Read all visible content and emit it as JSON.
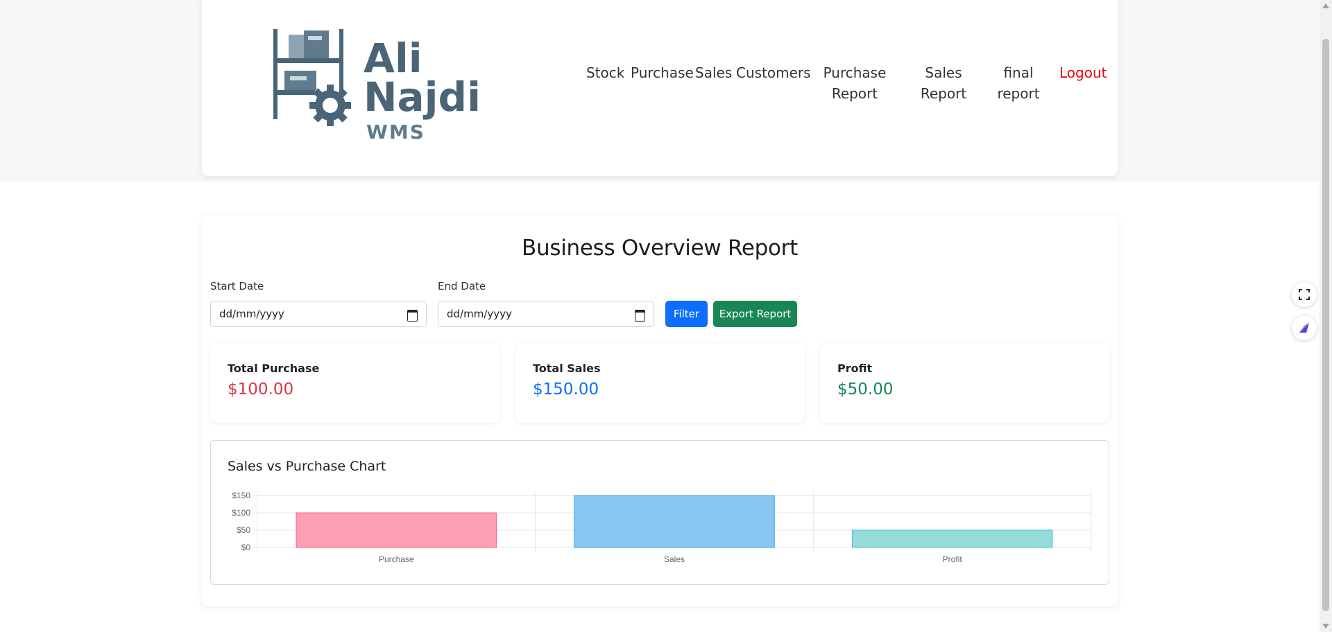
{
  "logo": {
    "line1": "Ali",
    "line2": "Najdi",
    "line3": "WMS",
    "color": "#4a6577"
  },
  "nav": {
    "items": [
      {
        "label": "Stock"
      },
      {
        "label": "Purchase"
      },
      {
        "label": "Sales"
      },
      {
        "label": "Customers"
      },
      {
        "label_line1": "Purchase",
        "label_line2": "Report"
      },
      {
        "label_line1": "Sales",
        "label_line2": "Report"
      },
      {
        "label_line1": "final",
        "label_line2": "report"
      },
      {
        "label": "Logout"
      }
    ]
  },
  "report": {
    "title": "Business Overview Report",
    "start_date_label": "Start Date",
    "start_date_value": "dd/mm/yyyy",
    "end_date_label": "End Date",
    "end_date_value": "dd/mm/yyyy",
    "filter_button": "Filter",
    "export_button": "Export Report"
  },
  "stats": [
    {
      "label": "Total Purchase",
      "value": "$100.00",
      "color": "#dc3545"
    },
    {
      "label": "Total Sales",
      "value": "$150.00",
      "color": "#0d6efd"
    },
    {
      "label": "Profit",
      "value": "$50.00",
      "color": "#198754"
    }
  ],
  "chart_data": {
    "type": "bar",
    "title": "Sales vs Purchase Chart",
    "categories": [
      "Purchase",
      "Sales",
      "Profit"
    ],
    "values": [
      100,
      150,
      50
    ],
    "colors": [
      "#ff9fb3",
      "#8ac6f2",
      "#96dbdc"
    ],
    "border_colors": [
      "#ff6384",
      "#36a2eb",
      "#4bc0c0"
    ],
    "ylim": [
      0,
      150
    ],
    "yticks": [
      "$150",
      "$100",
      "$50",
      "$0"
    ],
    "grid": true,
    "legend": "none"
  }
}
